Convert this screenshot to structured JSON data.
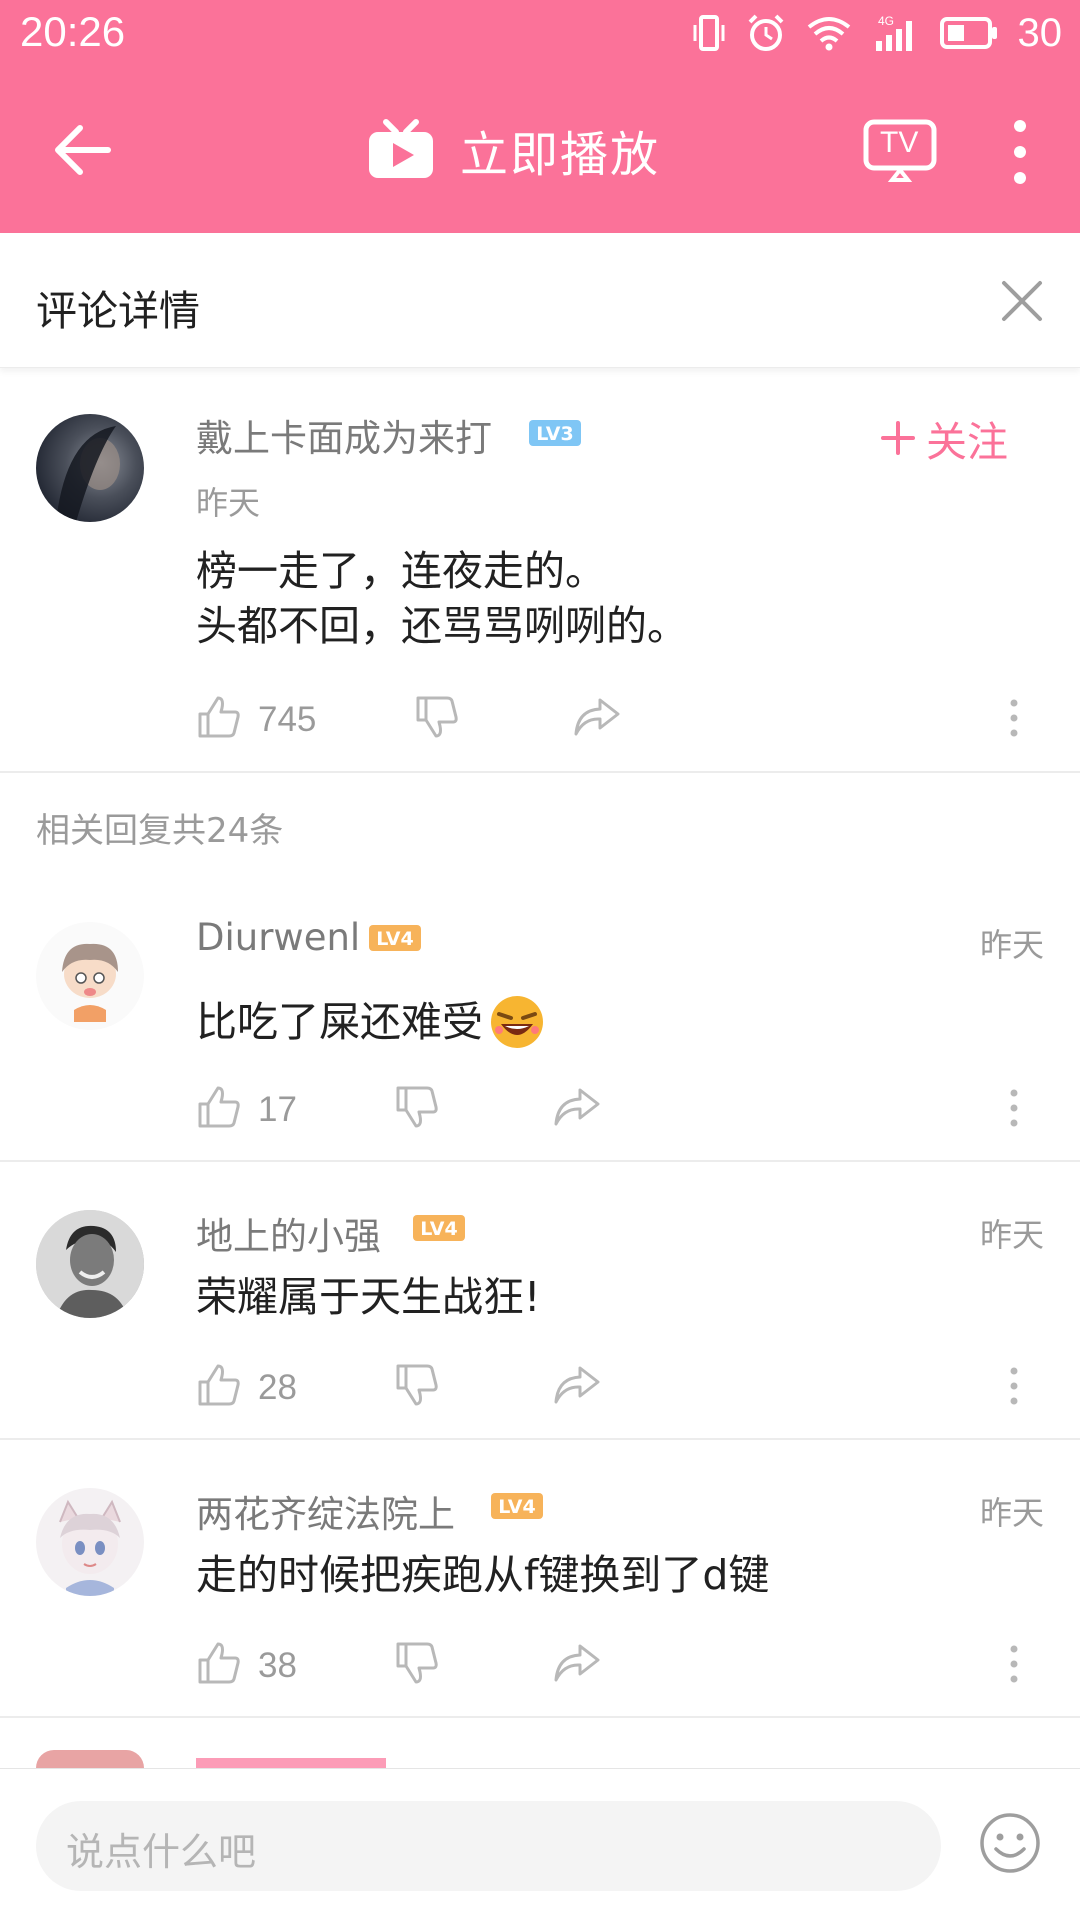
{
  "status_bar": {
    "time": "20:26",
    "battery": "30",
    "network": "4G"
  },
  "app_bar": {
    "title": "立即播放",
    "tv_label": "TV"
  },
  "sub_header": {
    "title": "评论详情"
  },
  "main_comment": {
    "username": "戴上卡面成为来打",
    "level": "LV3",
    "time": "昨天",
    "follow_label": "关注",
    "text_line1": "榜一走了，连夜走的。",
    "text_line2": "头都不回，还骂骂咧咧的。",
    "likes": "745"
  },
  "replies_header": "相关回复共24条",
  "replies": [
    {
      "username": "Diurwenl",
      "level": "LV4",
      "time": "昨天",
      "text": "比吃了屎还难受",
      "likes": "17"
    },
    {
      "username": "地上的小强",
      "level": "LV4",
      "time": "昨天",
      "text": "荣耀属于天生战狂!",
      "likes": "28"
    },
    {
      "username": "两花齐绽法院上",
      "level": "LV4",
      "time": "昨天",
      "text": "走的时候把疾跑从f键换到了d键",
      "likes": "38"
    }
  ],
  "input": {
    "placeholder": "说点什么吧"
  },
  "colors": {
    "brand_pink": "#fb7299",
    "level3_blue": "#7fc6f5",
    "level4_orange": "#f7b35a"
  },
  "icons": [
    "back-arrow-icon",
    "tv-play-icon",
    "cast-tv-icon",
    "more-vertical-icon",
    "close-icon",
    "like-icon",
    "dislike-icon",
    "share-icon",
    "emoji-icon"
  ]
}
